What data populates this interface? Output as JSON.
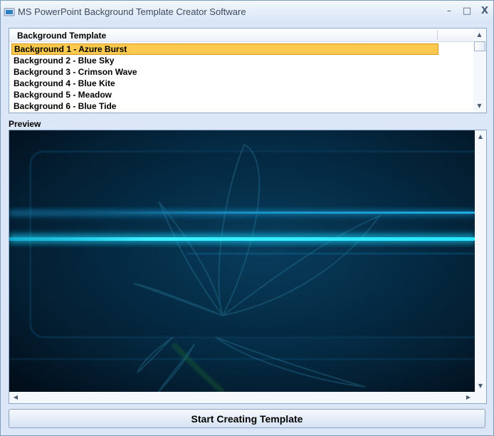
{
  "window": {
    "title": "MS PowerPoint Background Template Creator Software",
    "controls": {
      "minimize": "–",
      "maximize": "□",
      "close": "X"
    }
  },
  "list": {
    "column_header": "Background Template",
    "items": [
      {
        "label": "Background 1 - Azure Burst",
        "selected": true
      },
      {
        "label": "Background 2 - Blue Sky",
        "selected": false
      },
      {
        "label": "Background 3 - Crimson Wave",
        "selected": false
      },
      {
        "label": "Background 4 - Blue Kite",
        "selected": false
      },
      {
        "label": "Background 5 - Meadow",
        "selected": false
      },
      {
        "label": "Background 6 - Blue Tide",
        "selected": false
      }
    ],
    "scroll": {
      "up": "▲",
      "down": "▼"
    }
  },
  "preview": {
    "label": "Preview",
    "scroll": {
      "up": "▲",
      "down": "▼",
      "left": "◀",
      "right": "▶"
    }
  },
  "actions": {
    "start_label": "Start Creating Template"
  },
  "colors": {
    "selection": "#fbc94e",
    "glow": "#19e3ff",
    "preview_bg": "#031a2b"
  }
}
